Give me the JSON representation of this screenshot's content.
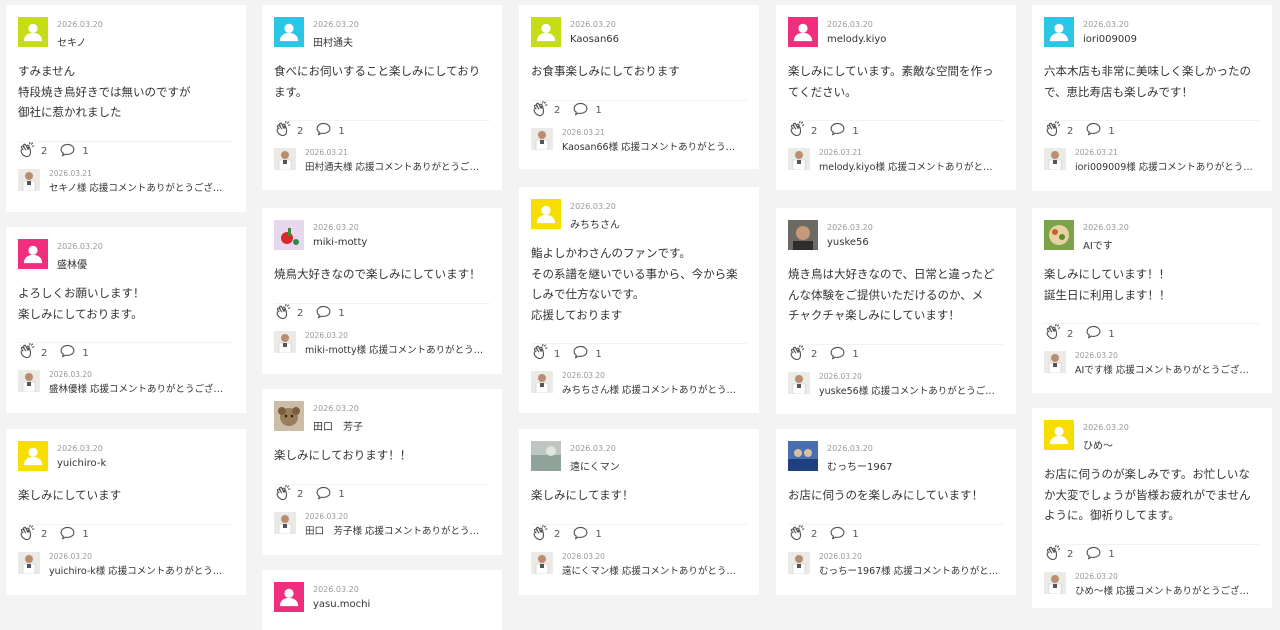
{
  "colors": {
    "lime": "#c5dc17",
    "cyan": "#29c6e6",
    "pink": "#ef2f7e",
    "yellow": "#f7dd00"
  },
  "columns": [
    {
      "cards": [
        {
          "avatar": "lime",
          "date": "2026.03.20",
          "name": "セキノ",
          "lines": [
            "すみません",
            "特段焼き鳥好きでは無いのですが",
            "御社に惹かれました"
          ],
          "claps": "2",
          "comments": "1",
          "reply": {
            "date": "2026.03.21",
            "text": "セキノ様 応援コメントありがとうござ…"
          }
        },
        {
          "avatar": "pink",
          "date": "2026.03.20",
          "name": "盛林優",
          "lines": [
            "よろしくお願いします！",
            "楽しみにしております。"
          ],
          "claps": "2",
          "comments": "1",
          "reply": {
            "date": "2026.03.20",
            "text": "盛林優様 応援コメントありがとうござ…"
          }
        },
        {
          "avatar": "yellow",
          "date": "2026.03.20",
          "name": "yuichiro-k",
          "lines": [
            "楽しみにしています"
          ],
          "claps": "2",
          "comments": "1",
          "reply": {
            "date": "2026.03.20",
            "text": "yuichiro-k様 応援コメントありがとう…"
          }
        }
      ]
    },
    {
      "cards": [
        {
          "avatar": "cyan",
          "date": "2026.03.20",
          "name": "田村通夫",
          "lines": [
            "食べにお伺いすること楽しみにしており",
            "ます。"
          ],
          "claps": "2",
          "comments": "1",
          "reply": {
            "date": "2026.03.21",
            "text": "田村通夫様 応援コメントありがとうご…"
          }
        },
        {
          "avatar": "photo-flower",
          "date": "2026.03.20",
          "name": "miki-motty",
          "lines": [
            "焼鳥大好きなので楽しみにしています！"
          ],
          "claps": "2",
          "comments": "1",
          "reply": {
            "date": "2026.03.20",
            "text": "miki-motty様 応援コメントありがとう…"
          }
        },
        {
          "avatar": "photo-dog",
          "date": "2026.03.20",
          "name": "田口　芳子",
          "lines": [
            "楽しみにしております！！"
          ],
          "claps": "2",
          "comments": "1",
          "reply": {
            "date": "2026.03.20",
            "text": "田口　芳子様 応援コメントありがとう…"
          }
        },
        {
          "avatar": "pink",
          "date": "2026.03.20",
          "name": "yasu.mochi",
          "lines": [],
          "claps": "",
          "comments": "",
          "reply": null
        }
      ]
    },
    {
      "cards": [
        {
          "avatar": "lime",
          "date": "2026.03.20",
          "name": "Kaosan66",
          "lines": [
            "お食事楽しみにしております"
          ],
          "claps": "2",
          "comments": "1",
          "reply": {
            "date": "2026.03.21",
            "text": "Kaosan66様 応援コメントありがとう…"
          }
        },
        {
          "avatar": "yellow",
          "date": "2026.03.20",
          "name": "みちちさん",
          "lines": [
            "鮨よしかわさんのファンです。",
            "その系譜を継いでいる事から、今から楽",
            "しみで仕方ないです。",
            "応援しております"
          ],
          "claps": "1",
          "comments": "1",
          "reply": {
            "date": "2026.03.20",
            "text": "みちちさん様 応援コメントありがとう…"
          }
        },
        {
          "avatar": "photo-gray",
          "date": "2026.03.20",
          "name": "遠にくマン",
          "lines": [
            "楽しみにしてます！"
          ],
          "claps": "2",
          "comments": "1",
          "reply": {
            "date": "2026.03.20",
            "text": "遠にくマン様 応援コメントありがとう…"
          }
        }
      ]
    },
    {
      "cards": [
        {
          "avatar": "pink",
          "date": "2026.03.20",
          "name": "melody.kiyo",
          "lines": [
            "楽しみにしています。素敵な空間を作っ",
            "てください。"
          ],
          "claps": "2",
          "comments": "1",
          "reply": {
            "date": "2026.03.21",
            "text": "melody.kiyo様 応援コメントありがと…"
          }
        },
        {
          "avatar": "photo-man",
          "date": "2026.03.20",
          "name": "yuske56",
          "lines": [
            "焼き鳥は大好きなので、日常と違ったど",
            "んな体験をご提供いただけるのか、メ",
            "チャクチャ楽しみにしています！"
          ],
          "claps": "2",
          "comments": "1",
          "reply": {
            "date": "2026.03.20",
            "text": "yuske56様 応援コメントありがとうご…"
          }
        },
        {
          "avatar": "photo-blue",
          "date": "2026.03.20",
          "name": "むっちー1967",
          "lines": [
            "お店に伺うのを楽しみにしています！"
          ],
          "claps": "2",
          "comments": "1",
          "reply": {
            "date": "2026.03.20",
            "text": "むっちー1967様 応援コメントありがと…"
          }
        }
      ]
    },
    {
      "cards": [
        {
          "avatar": "cyan",
          "date": "2026.03.20",
          "name": "iori009009",
          "lines": [
            "六本木店も非常に美味しく楽しかったの",
            "で、恵比寿店も楽しみです！"
          ],
          "claps": "2",
          "comments": "1",
          "reply": {
            "date": "2026.03.21",
            "text": "iori009009様 応援コメントありがとう…"
          }
        },
        {
          "avatar": "photo-food",
          "date": "2026.03.20",
          "name": "AIです",
          "lines": [
            "楽しみにしています！！",
            "誕生日に利用します！！"
          ],
          "claps": "2",
          "comments": "1",
          "reply": {
            "date": "2026.03.20",
            "text": "AIです様 応援コメントありがとうござ…"
          }
        },
        {
          "avatar": "yellow",
          "date": "2026.03.20",
          "name": "ひめ〜",
          "lines": [
            "お店に伺うのが楽しみです。お忙しいな",
            "か大変でしょうが皆様お疲れがでません",
            "ように。御祈りしてます。"
          ],
          "claps": "2",
          "comments": "1",
          "reply": {
            "date": "2026.03.20",
            "text": "ひめ〜様 応援コメントありがとうござ…"
          }
        }
      ]
    }
  ]
}
